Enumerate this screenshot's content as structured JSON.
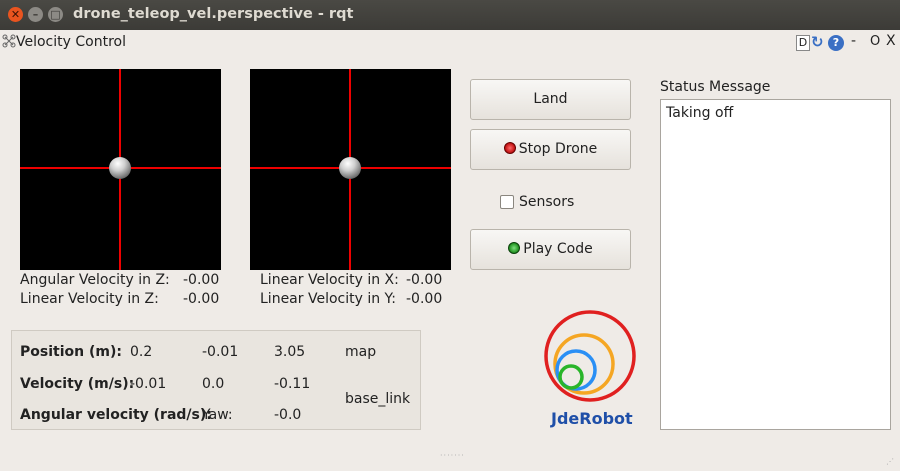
{
  "window": {
    "title": "drone_teleop_vel.perspective - rqt",
    "close_glyph": "✕",
    "minimize_glyph": "–",
    "maximize_glyph": "□"
  },
  "plugin": {
    "title": "Velocity Control",
    "icon": "drone-icon",
    "d_label": "D",
    "reload_glyph": "↻",
    "help_glyph": "?",
    "dash_label": "-",
    "o_label": "O",
    "x_label": "X"
  },
  "left_pad": {
    "labels": [
      {
        "name": "Angular Velocity in Z:",
        "value": "-0.00"
      },
      {
        "name": "Linear Velocity in Z:",
        "value": "-0.00"
      }
    ]
  },
  "right_pad": {
    "labels": [
      {
        "name": "Linear Velocity in X:",
        "value": "-0.00"
      },
      {
        "name": "Linear Velocity in Y:",
        "value": "-0.00"
      }
    ]
  },
  "buttons": {
    "land": "Land",
    "stop": "Stop Drone",
    "sensors": "Sensors",
    "play": "Play Code"
  },
  "sensors_checked": false,
  "status": {
    "title": "Status Message",
    "message": "Taking off"
  },
  "info": {
    "position": {
      "label": "Position (m):",
      "x": "0.2",
      "y": "-0.01",
      "z": "3.05",
      "frame": "map"
    },
    "velocity": {
      "label": "Velocity (m/s):",
      "x": "-0.01",
      "y": "0.0",
      "z": "-0.11",
      "frame": "base_link"
    },
    "angular": {
      "label": "Angular velocity (rad/s):",
      "axis": "Yaw:",
      "value": "-0.0"
    }
  },
  "logo": {
    "text": "JdeRobot"
  },
  "colors": {
    "crosshair": "#ee0000",
    "logo_red": "#e02020",
    "logo_orange": "#f5a623",
    "logo_blue": "#2a8ff5",
    "logo_green": "#2ab52a",
    "logo_text": "#1f4fa8"
  }
}
